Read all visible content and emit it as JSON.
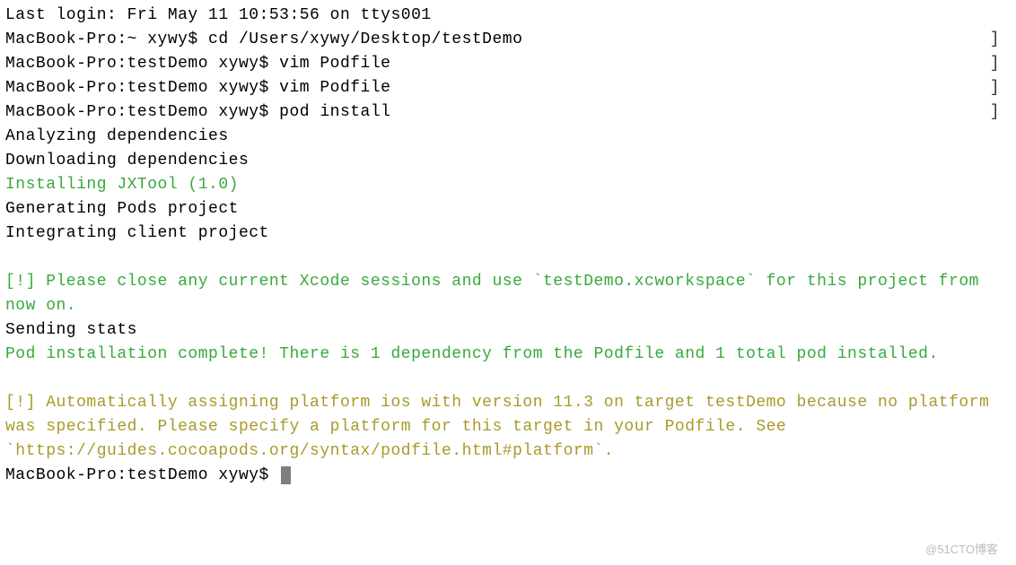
{
  "terminal": {
    "lines": [
      {
        "text": "Last login: Fri May 11 10:53:56 on ttys001",
        "class": "text-default",
        "bracket": false
      },
      {
        "text": "MacBook-Pro:~ xywy$ cd /Users/xywy/Desktop/testDemo",
        "class": "text-default",
        "bracket": true
      },
      {
        "text": "MacBook-Pro:testDemo xywy$ vim Podfile",
        "class": "text-default",
        "bracket": true
      },
      {
        "text": "MacBook-Pro:testDemo xywy$ vim Podfile",
        "class": "text-default",
        "bracket": true
      },
      {
        "text": "MacBook-Pro:testDemo xywy$ pod install",
        "class": "text-default",
        "bracket": true
      },
      {
        "text": "Analyzing dependencies",
        "class": "text-default",
        "bracket": false
      },
      {
        "text": "Downloading dependencies",
        "class": "text-default",
        "bracket": false
      },
      {
        "text": "Installing JXTool (1.0)",
        "class": "text-green",
        "bracket": false
      },
      {
        "text": "Generating Pods project",
        "class": "text-default",
        "bracket": false
      },
      {
        "text": "Integrating client project",
        "class": "text-default",
        "bracket": false
      },
      {
        "text": "",
        "class": "text-default",
        "bracket": false
      },
      {
        "text": "[!] Please close any current Xcode sessions and use `testDemo.xcworkspace` for this project from now on.",
        "class": "text-green",
        "bracket": false
      },
      {
        "text": "Sending stats",
        "class": "text-default",
        "bracket": false
      },
      {
        "text": "Pod installation complete! There is 1 dependency from the Podfile and 1 total pod installed.",
        "class": "text-green",
        "bracket": false
      },
      {
        "text": "",
        "class": "text-default",
        "bracket": false
      },
      {
        "text": "[!] Automatically assigning platform ios with version 11.3 on target testDemo because no platform was specified. Please specify a platform for this target in your Podfile. See `https://guides.cocoapods.org/syntax/podfile.html#platform`.",
        "class": "text-yellow",
        "bracket": false
      }
    ],
    "prompt": "MacBook-Pro:testDemo xywy$ ",
    "bracket_char": "]"
  },
  "watermark": "@51CTO博客"
}
